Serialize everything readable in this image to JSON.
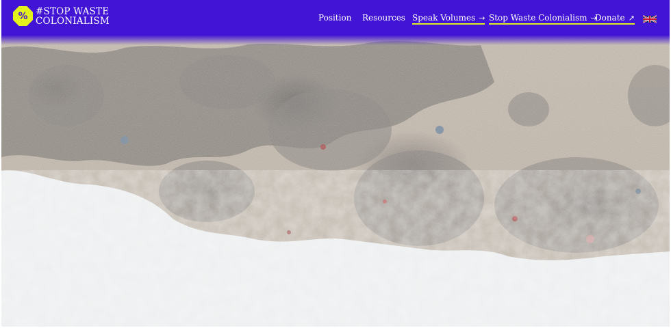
{
  "brand": {
    "badge_symbol": "%",
    "name_line1": "#STOP WASTE",
    "name_line2": "COLONIALISM",
    "badge_color": "#e4f21c"
  },
  "header": {
    "background_color": "#4214d5"
  },
  "nav": {
    "items": [
      {
        "label": "Position",
        "arrow": ""
      },
      {
        "label": "Resources",
        "arrow": ""
      },
      {
        "label": "Speak Volumes",
        "arrow": "→"
      },
      {
        "label": "Stop Waste Colonialism",
        "arrow": "→"
      },
      {
        "label": "Donate",
        "arrow": "↗"
      }
    ],
    "language_icon": "uk-flag-icon"
  },
  "hero": {
    "image": "aerial view of textile waste washed up on a beach with surf"
  }
}
